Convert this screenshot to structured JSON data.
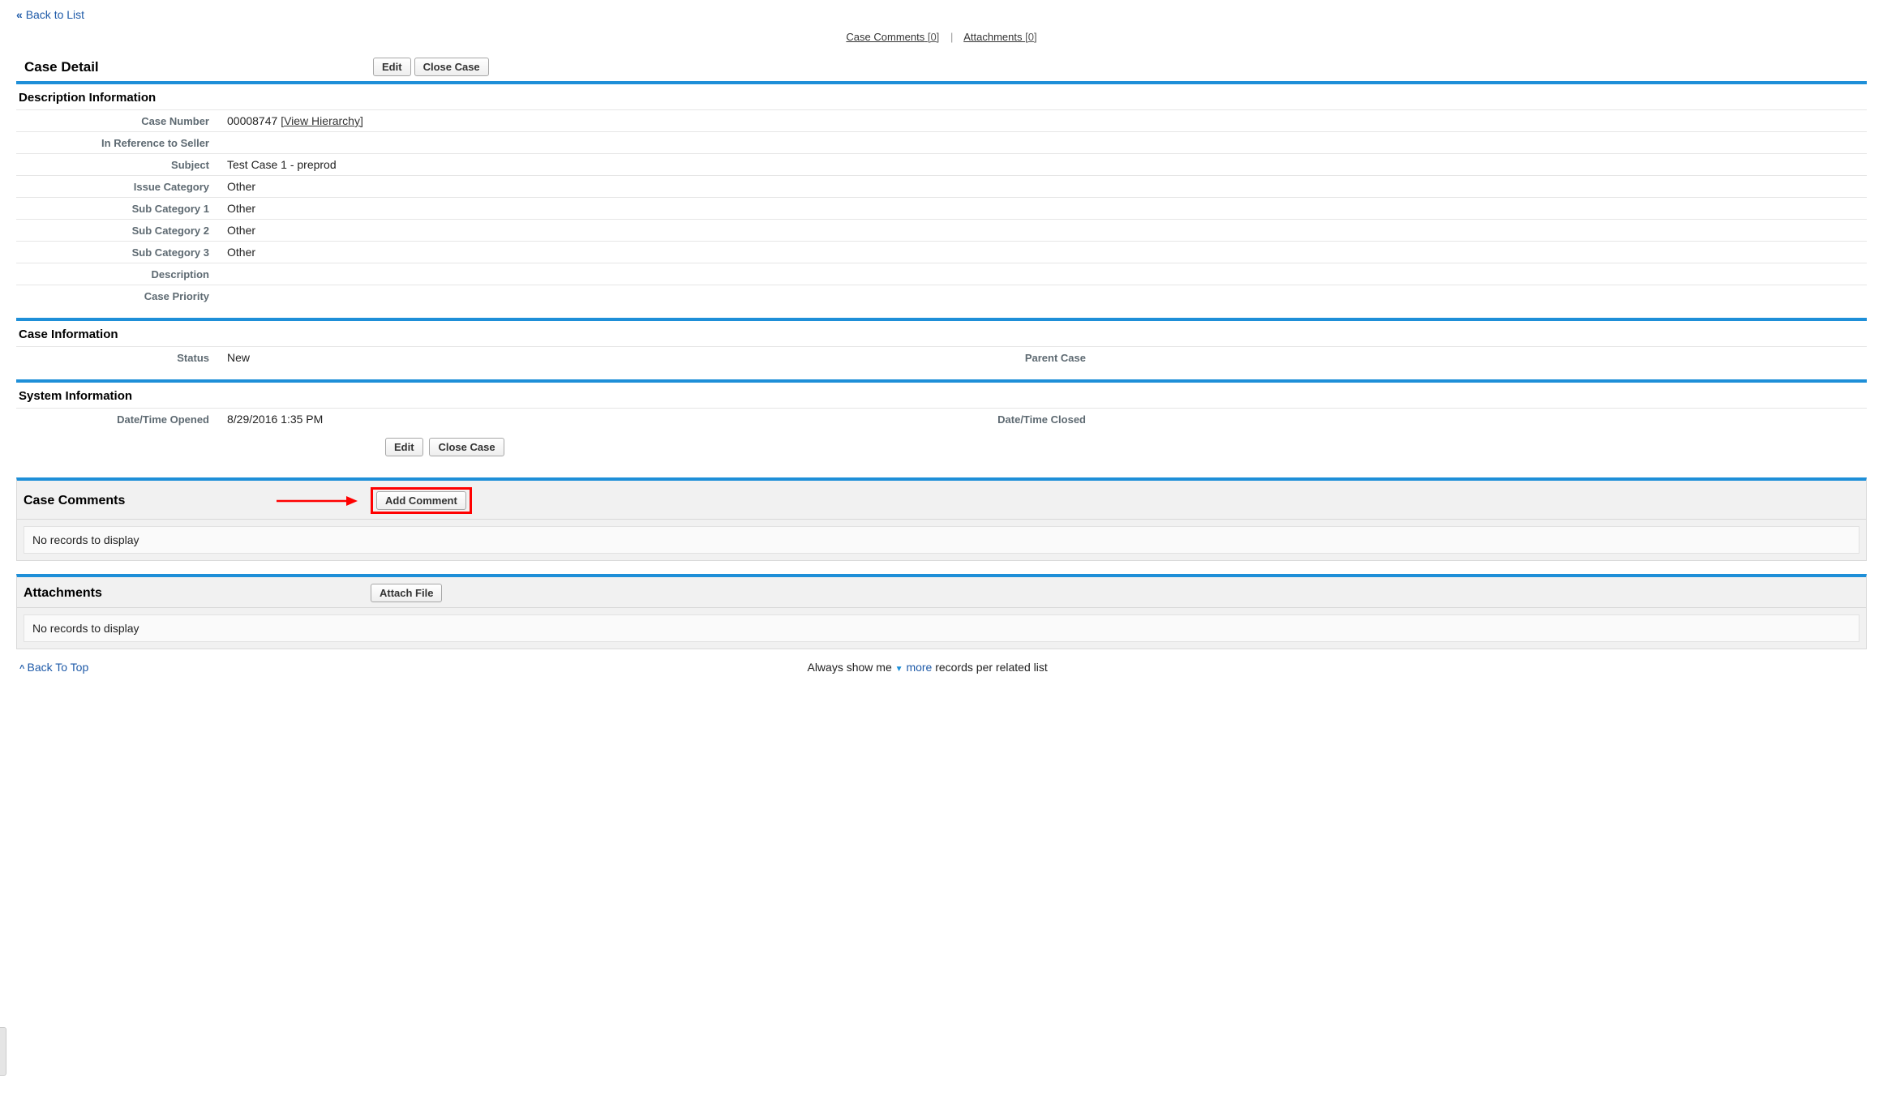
{
  "nav": {
    "back_link": "Back to List"
  },
  "anchors": {
    "comments_label": "Case Comments",
    "comments_count": "[0]",
    "attachments_label": "Attachments",
    "attachments_count": "[0]"
  },
  "detail": {
    "title": "Case Detail",
    "buttons": {
      "edit": "Edit",
      "close_case": "Close Case"
    }
  },
  "desc_section": {
    "header": "Description Information",
    "labels": {
      "case_number": "Case Number",
      "in_reference": "In Reference to Seller",
      "subject": "Subject",
      "issue_category": "Issue Category",
      "sub1": "Sub Category 1",
      "sub2": "Sub Category 2",
      "sub3": "Sub Category 3",
      "description": "Description",
      "priority": "Case Priority"
    },
    "values": {
      "case_number": "00008747",
      "view_hierarchy": "[View Hierarchy]",
      "in_reference": "",
      "subject": "Test Case 1 - preprod",
      "issue_category": "Other",
      "sub1": "Other",
      "sub2": "Other",
      "sub3": "Other",
      "description": "",
      "priority": ""
    }
  },
  "case_info_section": {
    "header": "Case Information",
    "labels": {
      "status": "Status",
      "parent_case": "Parent Case"
    },
    "values": {
      "status": "New",
      "parent_case": ""
    }
  },
  "system_section": {
    "header": "System Information",
    "labels": {
      "opened": "Date/Time Opened",
      "closed": "Date/Time Closed"
    },
    "values": {
      "opened": "8/29/2016 1:35 PM",
      "closed": ""
    }
  },
  "comments_section": {
    "title": "Case Comments",
    "button": "Add Comment",
    "empty": "No records to display"
  },
  "attachments_section": {
    "title": "Attachments",
    "button": "Attach File",
    "empty": "No records to display"
  },
  "footer": {
    "back_to_top": "Back To Top",
    "prefix": "Always show me ",
    "more": "more",
    "suffix": " records per related list"
  }
}
